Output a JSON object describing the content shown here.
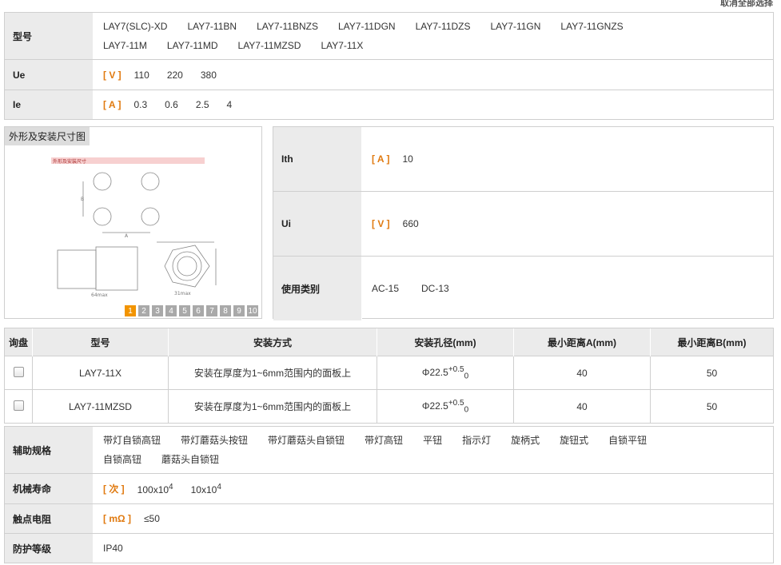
{
  "top_link": "取消全部选择",
  "section1": {
    "model_label": "型号",
    "models_line1": [
      "LAY7(SLC)-XD",
      "LAY7-11BN",
      "LAY7-11BNZS",
      "LAY7-11DGN",
      "LAY7-11DZS",
      "LAY7-11GN",
      "LAY7-11GNZS"
    ],
    "models_line2": [
      "LAY7-11M",
      "LAY7-11MD",
      "LAY7-11MZSD",
      "LAY7-11X"
    ],
    "ue_label": "Ue",
    "ue_unit": "[ V ]",
    "ue_values": [
      "110",
      "220",
      "380"
    ],
    "ie_label": "Ie",
    "ie_unit": "[ A ]",
    "ie_values": [
      "0.3",
      "0.6",
      "2.5",
      "4"
    ]
  },
  "image_panel": {
    "title": "外形及安装尺寸图",
    "drawing_caption": "外形及安装尺寸",
    "pages": [
      "1",
      "2",
      "3",
      "4",
      "5",
      "6",
      "7",
      "8",
      "9",
      "10"
    ],
    "active_page": "1"
  },
  "spec": {
    "ith_label": "Ith",
    "ith_unit": "[ A ]",
    "ith_value": "10",
    "ui_label": "Ui",
    "ui_unit": "[ V ]",
    "ui_value": "660",
    "usage_label": "使用类别",
    "usage_values": [
      "AC-15",
      "DC-13"
    ]
  },
  "table": {
    "headers": [
      "询盘",
      "型号",
      "安装方式",
      "安装孔径(mm)",
      "最小距离A(mm)",
      "最小距离B(mm)"
    ],
    "rows": [
      {
        "model": "LAY7-11X",
        "mount": "安装在厚度为1~6mm范围内的面板上",
        "hole_base": "Φ22.5",
        "hole_sup": "+0.5",
        "hole_sub": "0",
        "a": "40",
        "b": "50"
      },
      {
        "model": "LAY7-11MZSD",
        "mount": "安装在厚度为1~6mm范围内的面板上",
        "hole_base": "Φ22.5",
        "hole_sup": "+0.5",
        "hole_sub": "0",
        "a": "40",
        "b": "50"
      }
    ]
  },
  "section3": {
    "aux_label": "辅助规格",
    "aux_line1": [
      "带灯自锁高钮",
      "带灯蘑菇头按钮",
      "带灯蘑菇头自锁钮",
      "带灯高钮",
      "平钮",
      "指示灯",
      "旋柄式",
      "旋钮式",
      "自锁平钮"
    ],
    "aux_line2": [
      "自锁高钮",
      "蘑菇头自锁钮"
    ],
    "life_label": "机械寿命",
    "life_unit": "[ 次 ]",
    "life_values": [
      {
        "base": "100x10",
        "exp": "4"
      },
      {
        "base": "10x10",
        "exp": "4"
      }
    ],
    "contact_label": "触点电阻",
    "contact_unit": "[ mΩ ]",
    "contact_value": "≤50",
    "protect_label": "防护等级",
    "protect_value": "IP40"
  },
  "colors": {
    "unit": "#e07a10",
    "label_bg": "#ebebeb",
    "active_page": "#f29400",
    "border": "#cfcfcf"
  }
}
